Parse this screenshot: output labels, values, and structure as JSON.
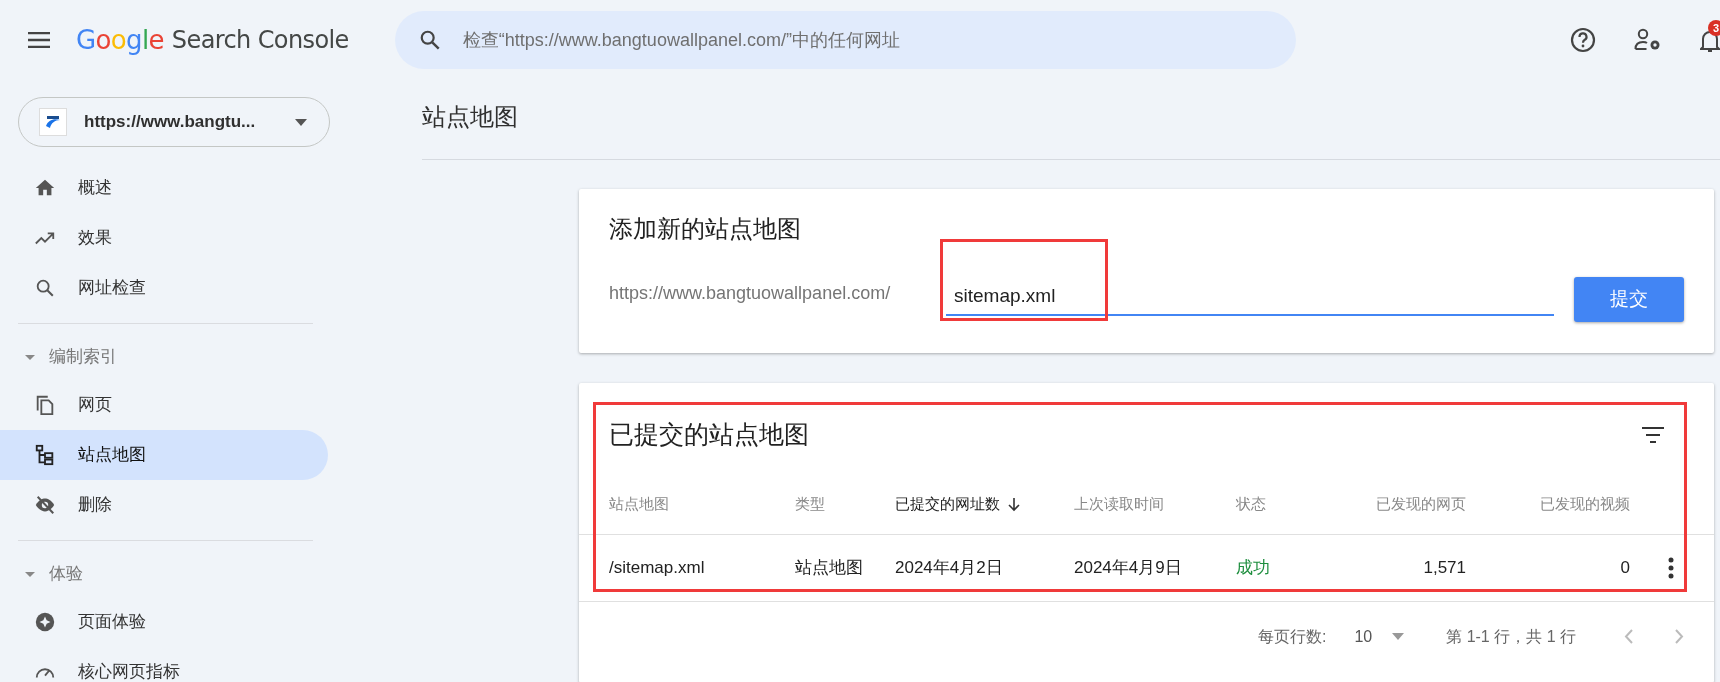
{
  "header": {
    "logo": "Google",
    "product": "Search Console",
    "search_placeholder": "检查“https://www.bangtuowallpanel.com/”中的任何网址",
    "notification_badge": "3"
  },
  "property": {
    "label": "https://www.bangtu..."
  },
  "sidebar": {
    "items": [
      {
        "kind": "item",
        "label": "概述",
        "selected": false
      },
      {
        "kind": "item",
        "label": "效果",
        "selected": false
      },
      {
        "kind": "item",
        "label": "网址检查",
        "selected": false
      },
      {
        "kind": "divider"
      },
      {
        "kind": "section",
        "label": "编制索引",
        "expanded": true
      },
      {
        "kind": "item",
        "label": "网页",
        "selected": false
      },
      {
        "kind": "item",
        "label": "站点地图",
        "selected": true
      },
      {
        "kind": "item",
        "label": "删除",
        "selected": false
      },
      {
        "kind": "divider"
      },
      {
        "kind": "section",
        "label": "体验",
        "expanded": true
      },
      {
        "kind": "item",
        "label": "页面体验",
        "selected": false
      },
      {
        "kind": "item",
        "label": "核心网页指标",
        "selected": false
      }
    ]
  },
  "page_title": "站点地图",
  "add_card": {
    "title": "添加新的站点地图",
    "url_prefix": "https://www.bangtuowallpanel.com/",
    "input_value": "sitemap.xml",
    "highlighted": true,
    "button": "提交"
  },
  "table_card": {
    "title": "已提交的站点地图",
    "highlighted": true,
    "columns": [
      {
        "label": "站点地图",
        "sorted": false
      },
      {
        "label": "类型",
        "sorted": false
      },
      {
        "label": "已提交的网址数",
        "sorted": true
      },
      {
        "label": "上次读取时间",
        "sorted": false
      },
      {
        "label": "状态",
        "sorted": false
      },
      {
        "label": "已发现的网页",
        "sorted": false
      },
      {
        "label": "已发现的视频",
        "sorted": false
      }
    ],
    "rows": [
      {
        "cells": [
          "/sitemap.xml",
          "站点地图",
          "2024年4月2日",
          "2024年4月9日",
          "成功",
          "1,571",
          "0"
        ]
      }
    ],
    "footer": {
      "rows_per_page_label": "每页行数:",
      "rows_per_page": "10",
      "range": "第 1-1 行，共 1 行"
    }
  }
}
